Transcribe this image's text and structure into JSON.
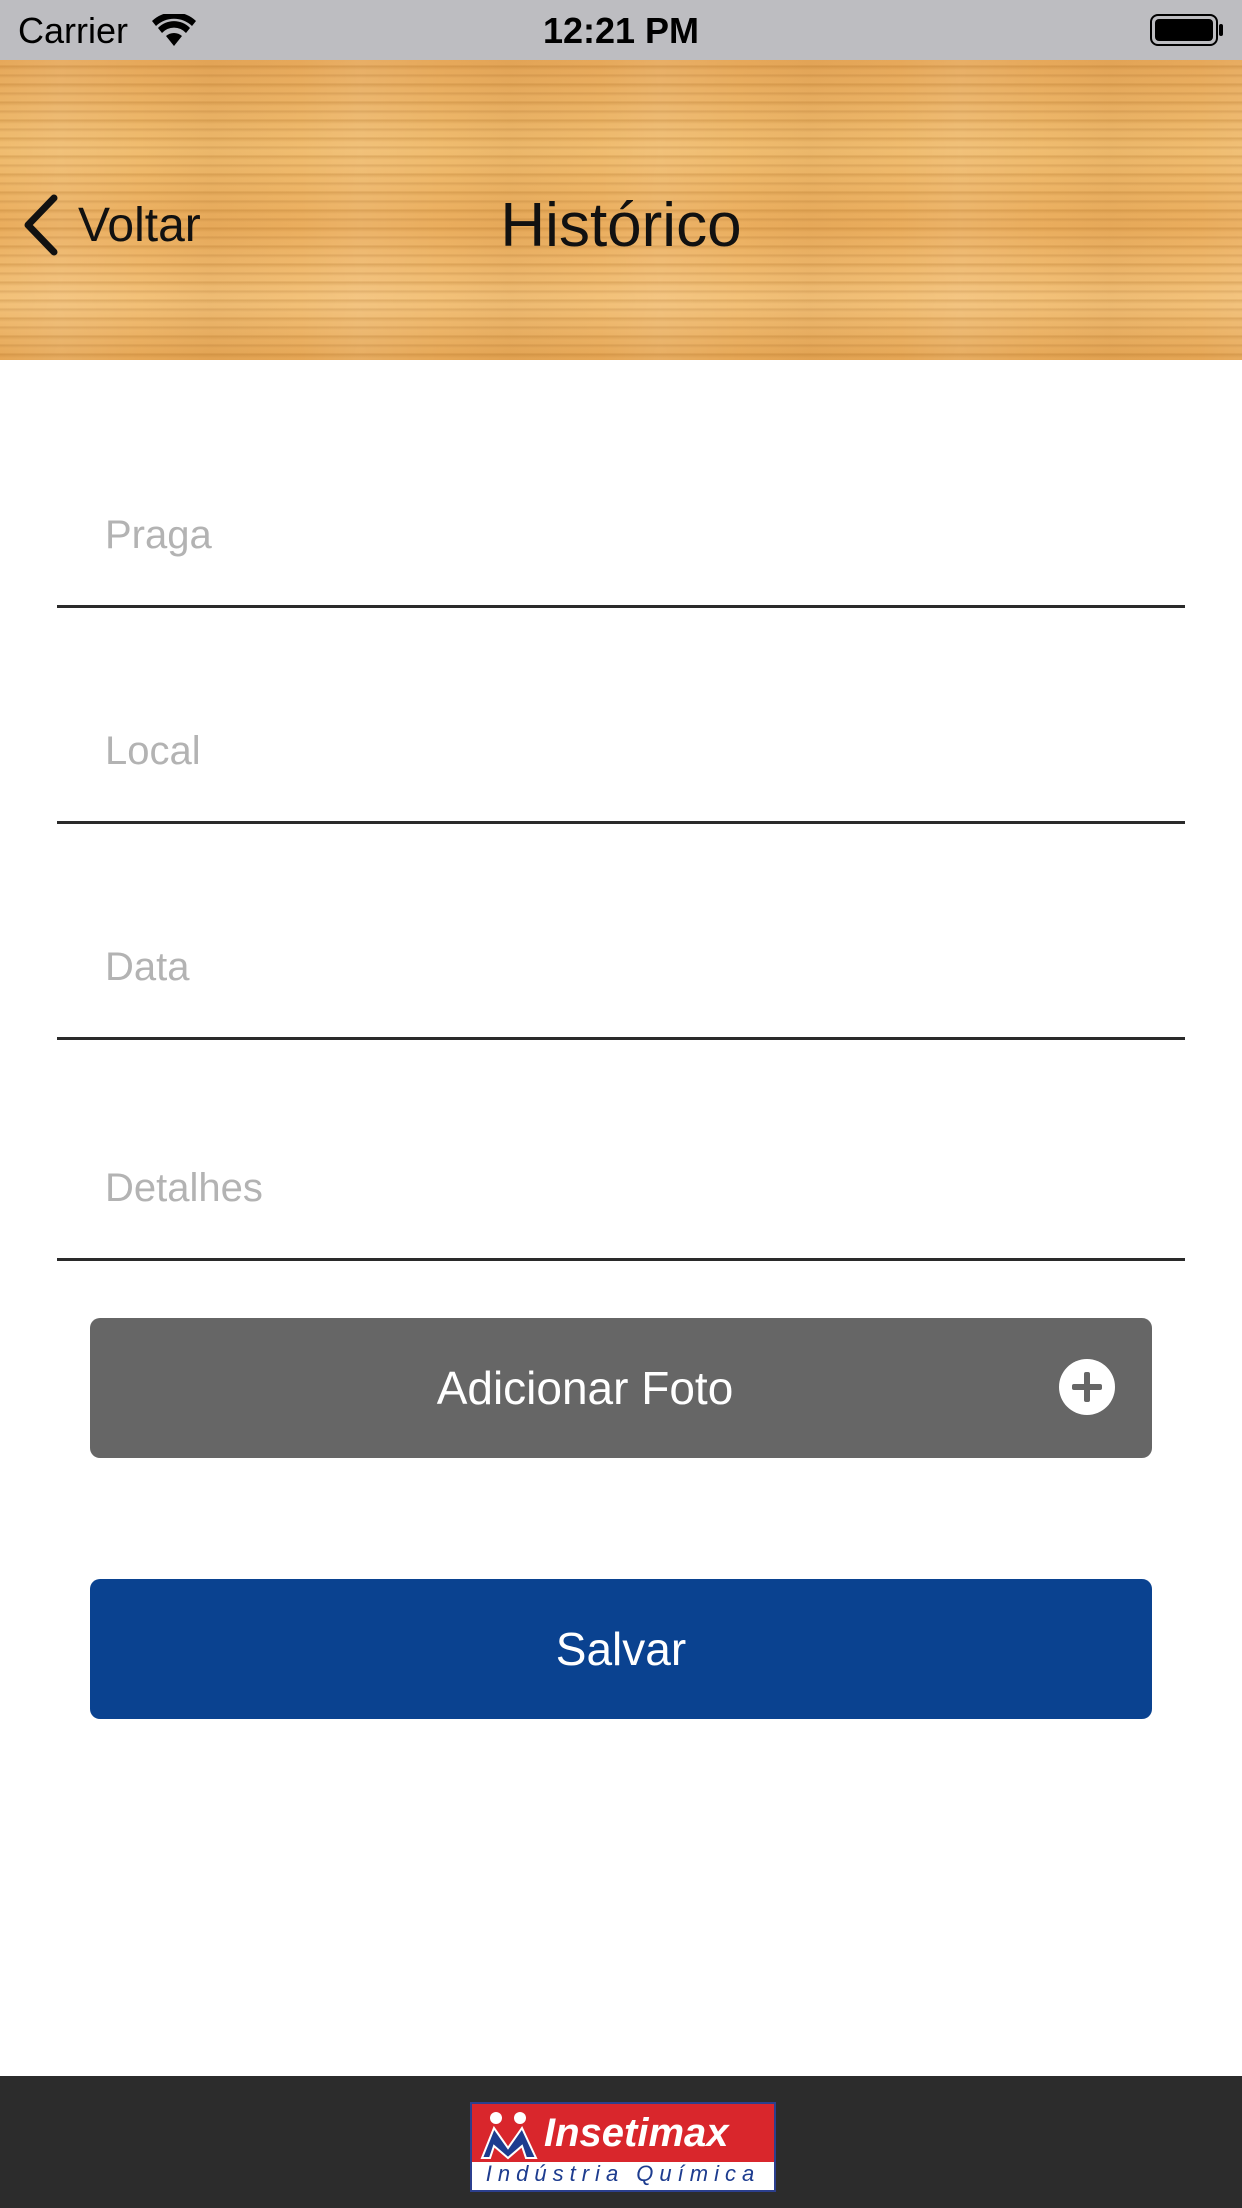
{
  "status_bar": {
    "carrier": "Carrier",
    "time": "12:21 PM"
  },
  "nav": {
    "back_label": "Voltar",
    "title": "Histórico"
  },
  "form": {
    "praga_placeholder": "Praga",
    "local_placeholder": "Local",
    "data_placeholder": "Data",
    "detalhes_placeholder": "Detalhes"
  },
  "buttons": {
    "add_photo_label": "Adicionar Foto",
    "save_label": "Salvar"
  },
  "footer": {
    "logo_brand": "Insetimax",
    "logo_subtitle": "Indústria Química"
  },
  "colors": {
    "photo_button": "#666666",
    "save_button": "#0a4290",
    "footer": "#2c2c2c",
    "logo_red": "#d9262c",
    "logo_blue": "#1d3c8f"
  },
  "icons": {
    "back": "chevron-left-icon",
    "add_photo": "plus-circle-icon",
    "wifi": "wifi-icon",
    "battery": "battery-icon"
  }
}
